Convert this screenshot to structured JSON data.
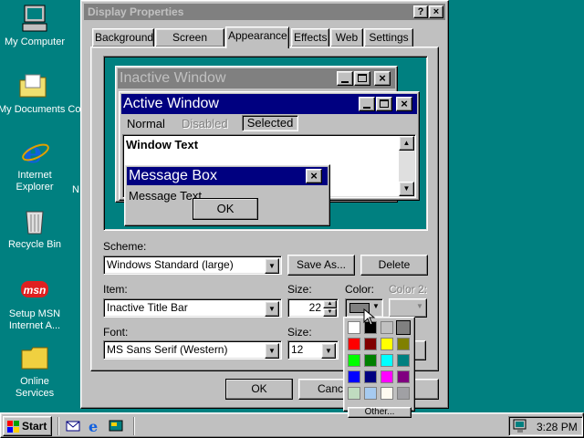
{
  "desktop": {
    "icons": [
      {
        "label": "My Computer",
        "icon": "computer-icon"
      },
      {
        "label": "My Documents Co",
        "icon": "folder-documents-icon"
      },
      {
        "label_line1": "Internet",
        "label_line2": "Explorer",
        "icon": "ie-icon"
      },
      {
        "label": "Recycle Bin",
        "icon": "recycle-bin-icon"
      },
      {
        "label_line1": "Setup MSN",
        "label_line2": "Internet A...",
        "icon": "msn-icon",
        "badge": "msn"
      },
      {
        "label_line1": "Online",
        "label_line2": "Services",
        "icon": "folder-icon"
      }
    ],
    "stray_text": "N"
  },
  "dialog": {
    "title": "Display Properties",
    "help_btn": "?",
    "close_btn": "×",
    "tabs": [
      "Background",
      "Screen Saver",
      "Appearance",
      "Effects",
      "Web",
      "Settings"
    ],
    "active_tab": "Appearance",
    "preview": {
      "inactive_title": "Inactive Window",
      "active_title": "Active Window",
      "menu": [
        "Normal",
        "Disabled",
        "Selected"
      ],
      "window_text": "Window Text",
      "msgbox_title": "Message Box",
      "msgbox_text": "Message Text",
      "msgbox_ok": "OK"
    },
    "scheme": {
      "label": "Scheme:",
      "value": "Windows Standard (large)",
      "save_as": "Save As...",
      "delete": "Delete"
    },
    "item": {
      "label": "Item:",
      "value": "Inactive Title Bar",
      "size_label": "Size:",
      "size_value": "22",
      "color_label": "Color:",
      "color2_label": "Color 2:"
    },
    "font": {
      "label": "Font:",
      "value": "MS Sans Serif (Western)",
      "size_label": "Size:",
      "size_value": "12"
    },
    "buttons": {
      "ok": "OK",
      "cancel": "Cance"
    },
    "color_picker": {
      "colors": [
        "#ffffff",
        "#000000",
        "#c0c0c0",
        "#808080",
        "#ff0000",
        "#800000",
        "#ffff00",
        "#808000",
        "#00ff00",
        "#008000",
        "#00ffff",
        "#008080",
        "#0000ff",
        "#000080",
        "#ff00ff",
        "#800080",
        "#c0dcc0",
        "#a6caf0",
        "#fffbf0",
        "#a0a0a4"
      ],
      "other_label": "Other..."
    }
  },
  "taskbar": {
    "start_label": "Start",
    "quicklaunch": [
      "outlook-express-icon",
      "ie-icon",
      "show-desktop-icon"
    ],
    "time": "3:28 PM"
  },
  "colors": {
    "desktop": "#008080",
    "active_title": "#000080",
    "inactive_title": "#808080",
    "face": "#c0c0c0"
  }
}
